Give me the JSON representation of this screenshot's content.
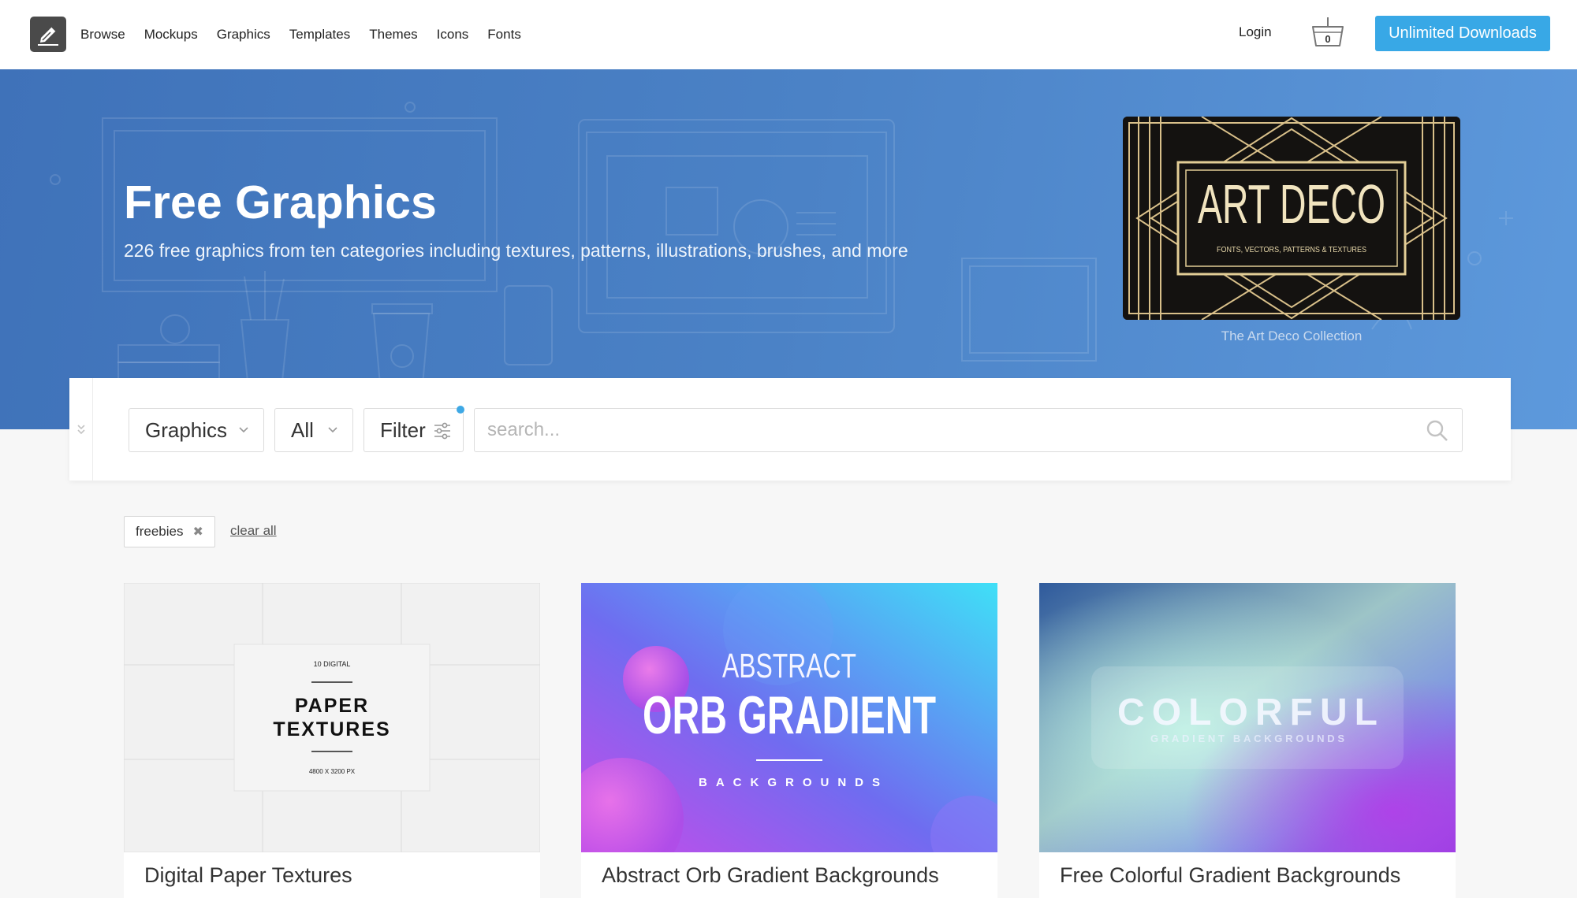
{
  "nav": {
    "items": [
      "Browse",
      "Mockups",
      "Graphics",
      "Templates",
      "Themes",
      "Icons",
      "Fonts"
    ],
    "login": "Login",
    "cart_count": "0",
    "cta": "Unlimited Downloads"
  },
  "hero": {
    "title": "Free Graphics",
    "subtitle": "226 free graphics from ten categories including textures, patterns, illustrations, brushes, and more",
    "feature": {
      "heading": "ART DECO",
      "subheading": "FONTS, VECTORS, PATTERNS & TEXTURES",
      "caption": "The Art Deco Collection"
    }
  },
  "search": {
    "category": "Graphics",
    "scope": "All",
    "filter_label": "Filter",
    "placeholder": "search..."
  },
  "tags": {
    "active": [
      "freebies"
    ],
    "clear_all": "clear all"
  },
  "cards": [
    {
      "title": "Digital Paper Textures",
      "thumb_lines": [
        "10 DIGITAL",
        "PAPER",
        "TEXTURES",
        "4800 X 3200 PX"
      ]
    },
    {
      "title": "Abstract Orb Gradient Backgrounds",
      "thumb_lines": [
        "ABSTRACT",
        "ORB GRADIENT",
        "BACKGROUNDS"
      ]
    },
    {
      "title": "Free Colorful Gradient Backgrounds",
      "thumb_lines": [
        "COLORFUL",
        "GRADIENT BACKGROUNDS"
      ]
    }
  ],
  "colors": {
    "accent": "#38a8e6",
    "hero": "#4b82c6"
  }
}
